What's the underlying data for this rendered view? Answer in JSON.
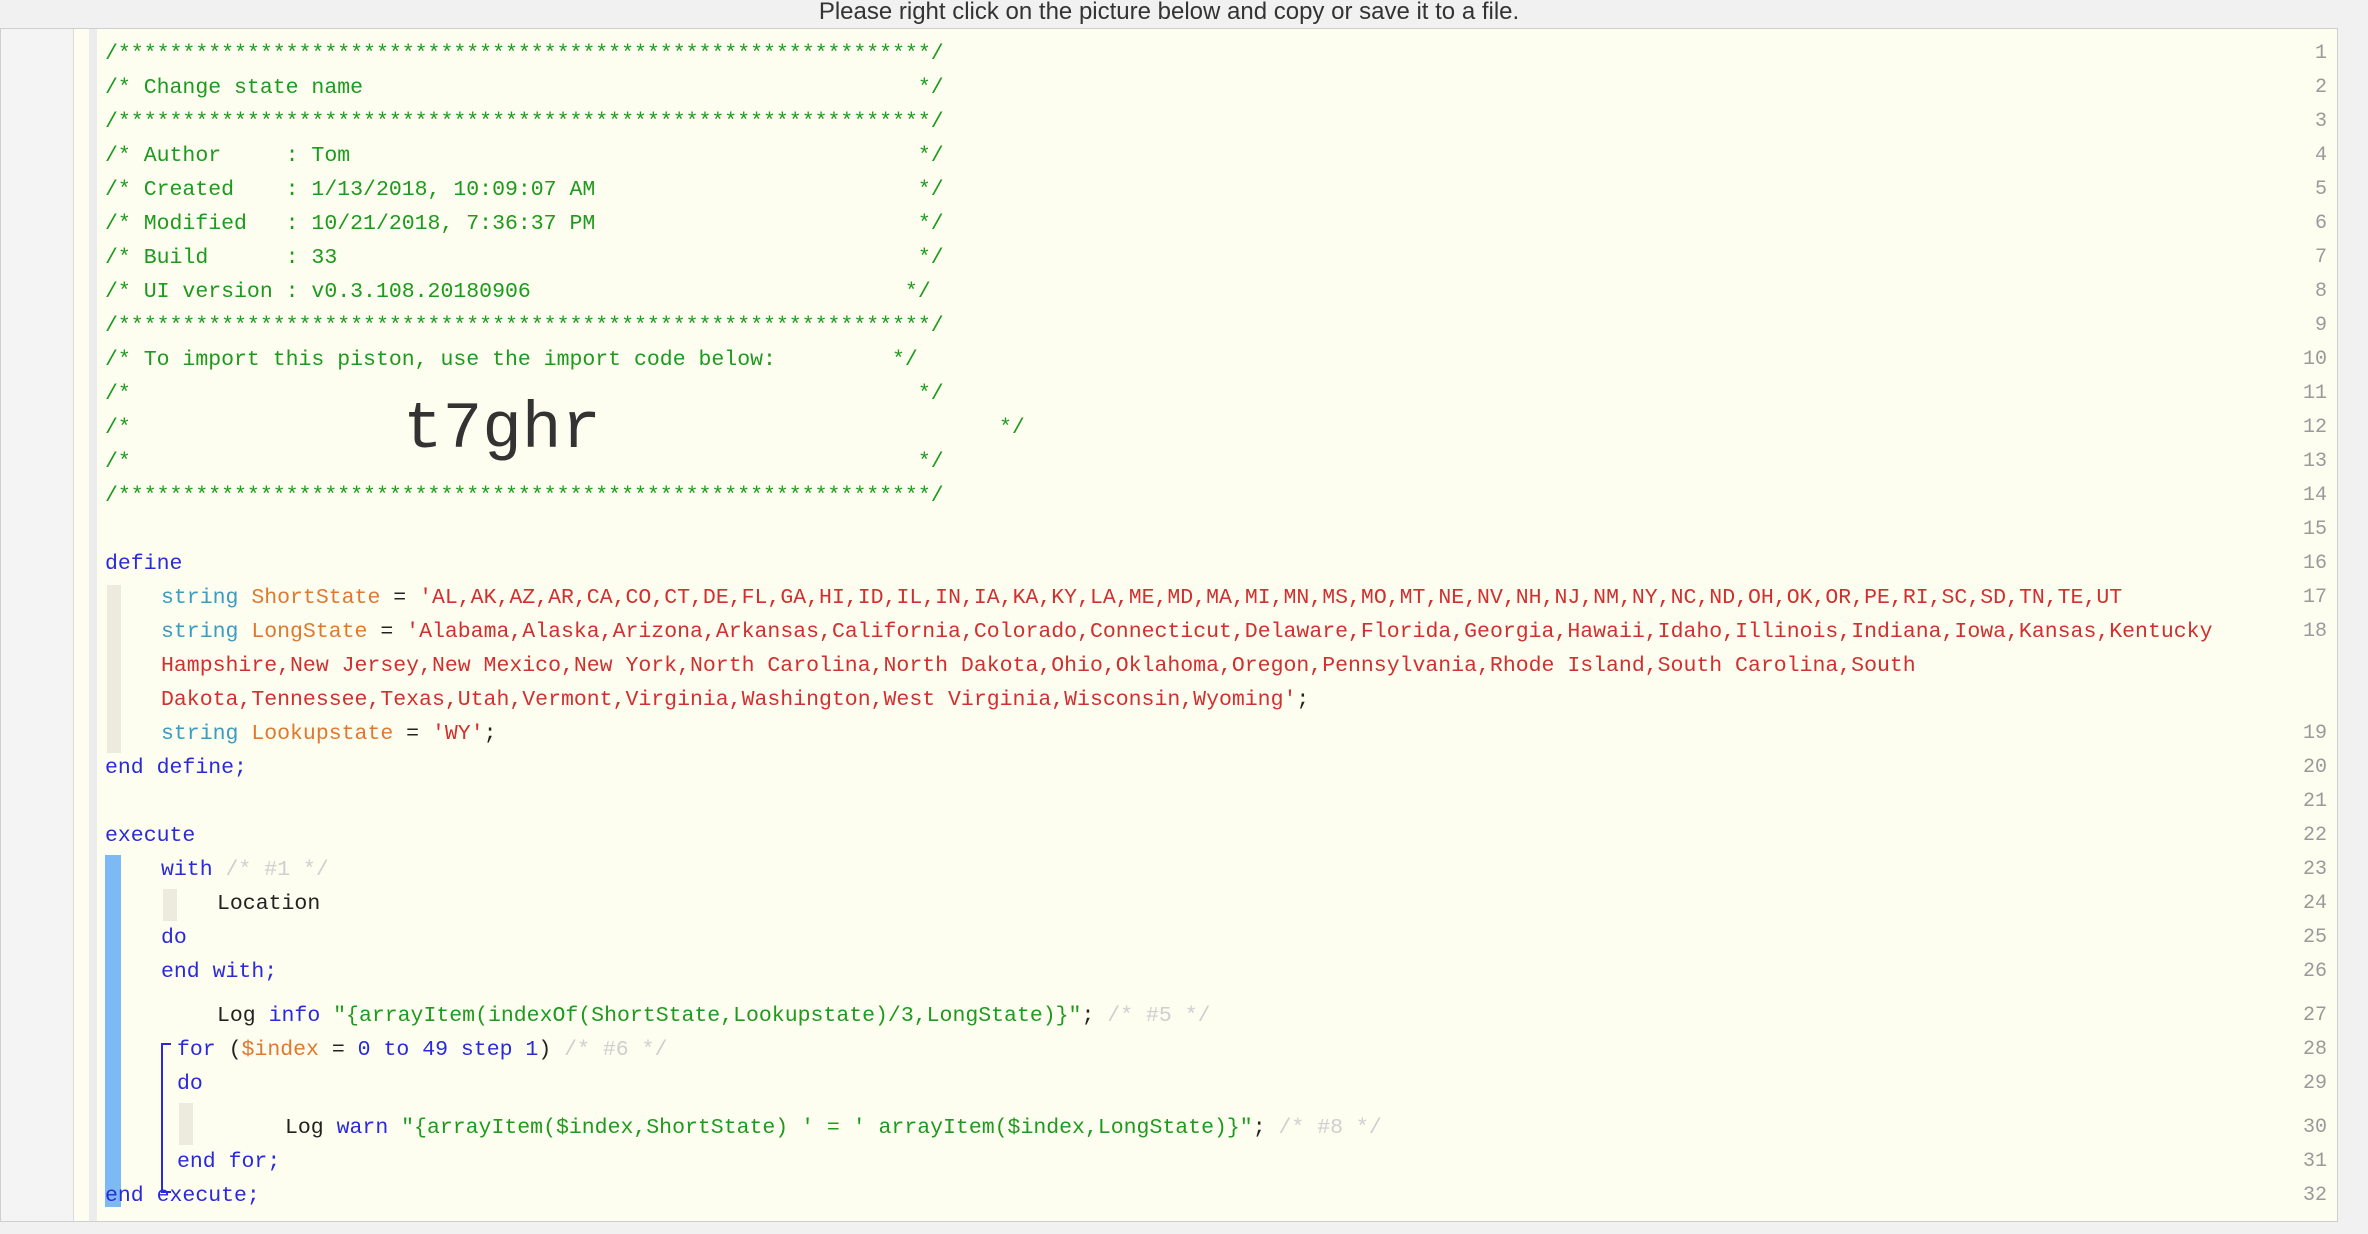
{
  "notice": "Please right click on the picture below and copy or save it to a file.",
  "line_numbers": [
    "1",
    "2",
    "3",
    "4",
    "5",
    "6",
    "7",
    "8",
    "9",
    "10",
    "11",
    "12",
    "13",
    "14",
    "15",
    "16",
    "17",
    "18",
    "19",
    "20",
    "21",
    "22",
    "23",
    "24",
    "25",
    "26",
    "27",
    "28",
    "29",
    "30",
    "31",
    "32"
  ],
  "header": {
    "border": "/***************************************************************/",
    "title": "/* Change state name                                           */",
    "author": "/* Author     : Tom                                            */",
    "created": "/* Created    : 1/13/2018, 10:09:07 AM                         */",
    "modified": "/* Modified   : 10/21/2018, 7:36:37 PM                         */",
    "build": "/* Build      : 33                                             */",
    "ui_version": "/* UI version : v0.3.108.20180906                             */",
    "import_note": "/* To import this piston, use the import code below:         */",
    "blank": "/*                                                             */",
    "code_prefix": "/*",
    "code_suffix": "*/",
    "import_code": "t7ghr"
  },
  "define": {
    "kw_define": "define",
    "kw_end_define": "end define;",
    "type": "string",
    "eq": " = ",
    "semi": ";",
    "short_name": "ShortState",
    "short_value": "'AL,AK,AZ,AR,CA,CO,CT,DE,FL,GA,HI,ID,IL,IN,IA,KA,KY,LA,ME,MD,MA,MI,MN,MS,MO,MT,NE,NV,NH,NJ,NM,NY,NC,ND,OH,OK,OR,PE,RI,SC,SD,TN,TE,UT",
    "long_name": "LongState",
    "long_value_1": "'Alabama,Alaska,Arizona,Arkansas,California,Colorado,Connecticut,Delaware,Florida,Georgia,Hawaii,Idaho,Illinois,Indiana,Iowa,Kansas,Kentucky",
    "long_value_2": "Hampshire,New Jersey,New Mexico,New York,North Carolina,North Dakota,Ohio,Oklahoma,Oregon,Pennsylvania,Rhode Island,South Carolina,South",
    "long_value_3": "Dakota,Tennessee,Texas,Utah,Vermont,Virginia,Washington,West Virginia,Wisconsin,Wyoming'",
    "lookup_name": "Lookupstate",
    "lookup_value": "'WY'"
  },
  "execute": {
    "kw_execute": "execute",
    "kw_with": "with",
    "with_comment": "/* #1 */",
    "location": "Location",
    "kw_do": "do",
    "kw_end_with": "end with;",
    "log1_kw": "Log",
    "log1_level": "info",
    "log1_expr": "\"{arrayItem(indexOf(ShortState,Lookupstate)/3,LongState)}\"",
    "log1_comment": "/* #5 */",
    "for_kw": "for",
    "for_open": " (",
    "for_var": "$index",
    "for_eq": " = ",
    "for_start": "0",
    "for_to": " to ",
    "for_end": "49",
    "for_step": " step ",
    "for_step_val": "1",
    "for_close": ")",
    "for_comment": "/* #6 */",
    "log2_kw": "Log",
    "log2_level": "warn",
    "log2_expr": "\"{arrayItem($index,ShortState) ' = ' arrayItem($index,LongState)}\"",
    "log2_comment": "/* #8 */",
    "kw_end_for": "end for;",
    "kw_end_execute": "end execute;"
  }
}
